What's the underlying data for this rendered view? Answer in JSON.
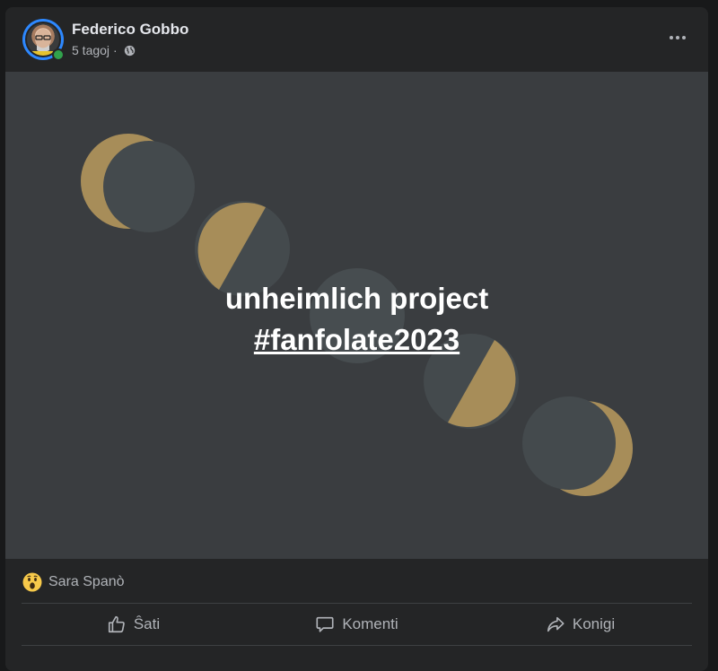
{
  "post": {
    "author": "Federico Gobbo",
    "time": "5 tagoj",
    "separator": "·",
    "privacy_icon": "globe-icon",
    "more_icon": "more-horizontal-icon",
    "online": true,
    "image_text": {
      "line1": "unheimlich project",
      "hashtag": "#fanfolate2023"
    },
    "colors": {
      "card": "#242526",
      "image_bg": "#3a3d40",
      "moon_gold": "#a78d59",
      "moon_dark": "#444a4d",
      "online": "#31a24c"
    }
  },
  "reactions": {
    "icon": "wow-reaction-icon",
    "names": "Sara Spanò"
  },
  "actions": {
    "like_label": "Ŝati",
    "comment_label": "Komenti",
    "share_label": "Konigi"
  }
}
